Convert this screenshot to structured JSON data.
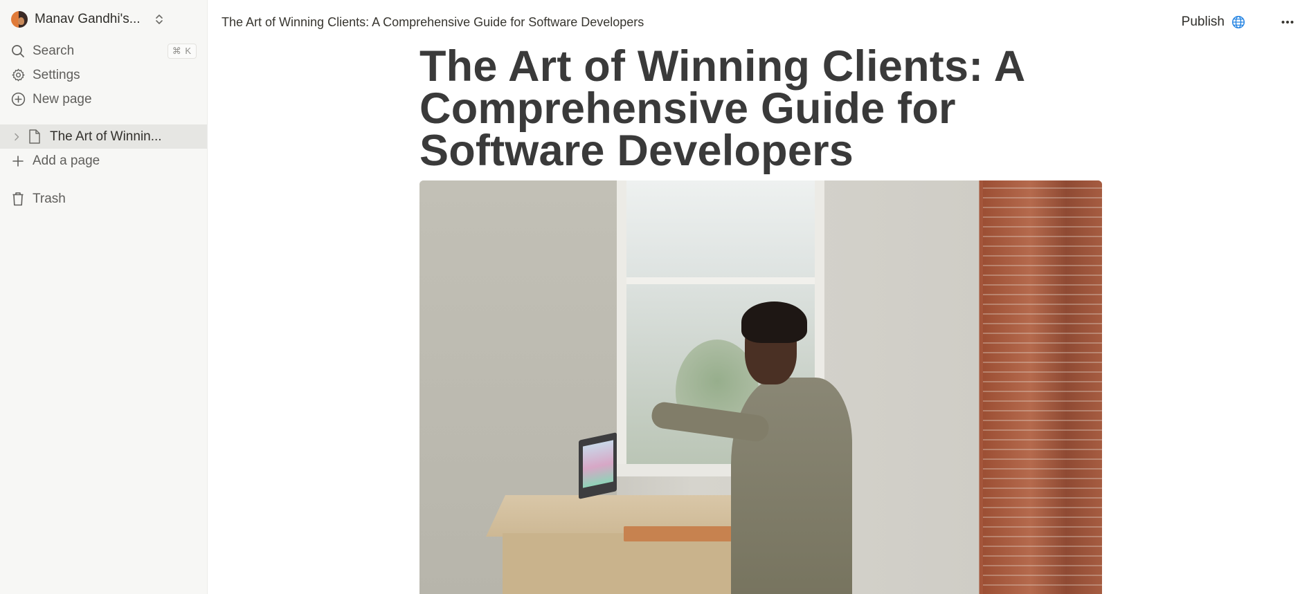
{
  "sidebar": {
    "workspace_name": "Manav Gandhi's...",
    "nav": {
      "search_label": "Search",
      "search_shortcut": "⌘ K",
      "settings_label": "Settings",
      "new_page_label": "New page"
    },
    "pages": [
      {
        "label": "The Art of Winnin..."
      }
    ],
    "add_page_label": "Add a page",
    "trash_label": "Trash"
  },
  "topbar": {
    "breadcrumb": "The Art of Winning Clients: A Comprehensive Guide for Software Developers",
    "publish_label": "Publish"
  },
  "page": {
    "title": "The Art of Winning Clients: A Comprehensive Guide for Software Developers"
  },
  "icons": {
    "search": "search-icon",
    "settings": "gear-icon",
    "new_page": "plus-circle-icon",
    "page": "document-icon",
    "expand": "chevron-right-icon",
    "add": "plus-icon",
    "trash": "trash-icon",
    "publish": "globe-icon",
    "more": "more-horizontal-icon",
    "switch": "chevron-up-down-icon"
  },
  "colors": {
    "sidebar_bg": "#f7f7f5",
    "selected_bg": "#e6e6e3",
    "text": "#37352f",
    "globe_accent": "#2383e2"
  }
}
